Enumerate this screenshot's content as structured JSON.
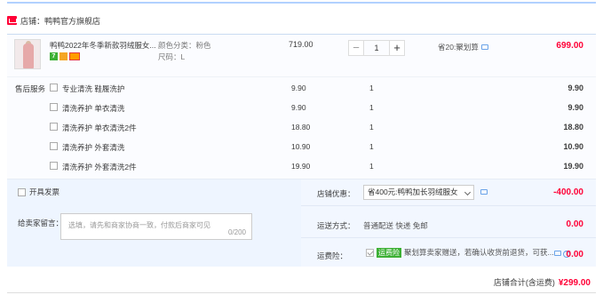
{
  "shop": {
    "label": "店铺：鸭鸭官方旗舰店"
  },
  "item": {
    "title": "鸭鸭2022年冬季新款羽绒服女...",
    "sku_color": "颜色分类：粉色",
    "sku_size": "尺码：L",
    "unit_price": "719.00",
    "quantity": "1",
    "minus": "−",
    "plus": "+",
    "save_text": "省20:聚划算",
    "total": "699.00",
    "badges": [
      "7",
      "",
      ""
    ]
  },
  "services": {
    "caption": "售后服务",
    "rows": [
      {
        "name": "专业清洗 鞋履洗护",
        "price": "9.90",
        "qty": "1",
        "total": "9.90"
      },
      {
        "name": "清洗养护 单衣清洗",
        "price": "9.90",
        "qty": "1",
        "total": "9.90"
      },
      {
        "name": "清洗养护 单衣清洗2件",
        "price": "18.80",
        "qty": "1",
        "total": "18.80"
      },
      {
        "name": "清洗养护 外套清洗",
        "price": "10.90",
        "qty": "1",
        "total": "10.90"
      },
      {
        "name": "清洗养护 外套清洗2件",
        "price": "19.90",
        "qty": "1",
        "total": "19.90"
      }
    ]
  },
  "invoice": {
    "label": "开具发票"
  },
  "message": {
    "caption": "给卖家留言：",
    "placeholder": "选填，请先和商家协商一致，付款后商家可见",
    "count": "0/200"
  },
  "discount": {
    "caption": "店铺优惠：",
    "selected": "省400元:鸭鸭加长羽绒服女",
    "value": "-400.00"
  },
  "shipping": {
    "caption": "运送方式：",
    "method": "普通配送 快递 免邮",
    "value": "0.00"
  },
  "insurance": {
    "caption": "运费险：",
    "tag": "运费险",
    "text": "聚划算卖家赠送，若确认收货前退货，可获...",
    "value": "0.00"
  },
  "grand_total": {
    "caption": "店铺合计(含运费)",
    "value": "¥299.00"
  }
}
